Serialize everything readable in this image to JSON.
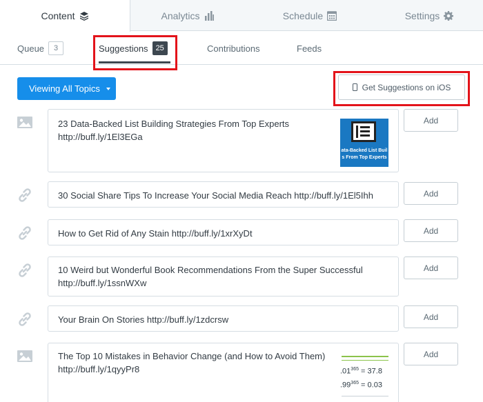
{
  "top_tabs": [
    {
      "label": "Content",
      "icon": "layers-icon"
    },
    {
      "label": "Analytics",
      "icon": "bar-chart-icon"
    },
    {
      "label": "Schedule",
      "icon": "calendar-icon"
    },
    {
      "label": "Settings",
      "icon": "gear-icon"
    }
  ],
  "sub_tabs": [
    {
      "label": "Queue",
      "count": "3"
    },
    {
      "label": "Suggestions",
      "count": "25"
    },
    {
      "label": "Contributions"
    },
    {
      "label": "Feeds"
    }
  ],
  "toolbar": {
    "topics_label": "Viewing All Topics",
    "ios_label": "Get Suggestions on iOS"
  },
  "suggestions": [
    {
      "type": "image",
      "text": "23 Data-Backed List Building Strategies From Top Experts http://buff.ly/1El3EGa",
      "add_label": "Add"
    },
    {
      "type": "link",
      "text": "30 Social Share Tips To Increase Your Social Media Reach http://buff.ly/1El5Ihh",
      "add_label": "Add"
    },
    {
      "type": "link",
      "text": "How to Get Rid of Any Stain http://buff.ly/1xrXyDt",
      "add_label": "Add"
    },
    {
      "type": "link",
      "text": "10 Weird but Wonderful Book Recommendations From the Super Successful http://buff.ly/1ssnWXw",
      "add_label": "Add"
    },
    {
      "type": "link",
      "text": "Your Brain On Stories http://buff.ly/1zdcrsw",
      "add_label": "Add"
    },
    {
      "type": "image",
      "text": "The Top 10 Mistakes in Behavior Change (and How to Avoid Them) http://buff.ly/1qyyPr8",
      "add_label": "Add"
    }
  ],
  "thumbnails": {
    "list_building_caption": "ata-Backed List Buil s From Top Experts",
    "behavior_eq1": ".01",
    "behavior_eq1_exp": "365",
    "behavior_eq1_result": "= 37.8",
    "behavior_eq2": ".99",
    "behavior_eq2_exp": "365",
    "behavior_eq2_result": "= 0.03"
  },
  "colors": {
    "accent": "#168eea",
    "highlight": "#e3131a",
    "active_tab": "#3d4750"
  }
}
